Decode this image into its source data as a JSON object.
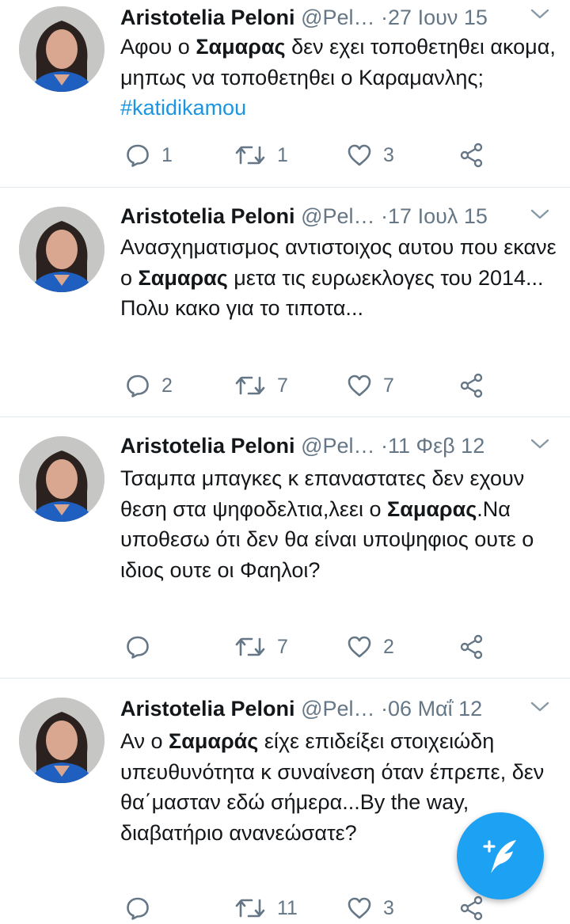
{
  "tweets": [
    {
      "name": "Aristotelia Peloni",
      "handle": "@Pel…",
      "dot": "·",
      "date": "27 Ιουν 15",
      "segments": [
        {
          "text": "Αφου ο ",
          "style": "normal"
        },
        {
          "text": "Σαμαρας",
          "style": "bold"
        },
        {
          "text": " δεν εχει τοποθετηθει ακομα, μηπως να τοποθετηθει ο Καραμανλης; ",
          "style": "normal"
        },
        {
          "text": "#katidikamou",
          "style": "hashtag"
        }
      ],
      "replies": "1",
      "retweets": "1",
      "likes": "3"
    },
    {
      "name": "Aristotelia Peloni",
      "handle": "@Pel…",
      "dot": "·",
      "date": "17 Ιουλ 15",
      "segments": [
        {
          "text": "Ανασχηματισμος αντιστοιχος αυτου που εκανε ο ",
          "style": "normal"
        },
        {
          "text": "Σαμαρας",
          "style": "bold"
        },
        {
          "text": " μετα τις ευρωεκλογες του 2014... Πολυ κακο για το τιποτα...",
          "style": "normal"
        }
      ],
      "replies": "2",
      "retweets": "7",
      "likes": "7"
    },
    {
      "name": "Aristotelia Peloni",
      "handle": "@Pel…",
      "dot": "·",
      "date": "11 Φεβ 12",
      "segments": [
        {
          "text": "Τσαμπα μπαγκες κ επαναστατες δεν εχουν θεση στα ψηφοδελτια,λεει ο ",
          "style": "normal"
        },
        {
          "text": "Σαμαρας",
          "style": "bold"
        },
        {
          "text": ".Να υποθεσω ότι δεν θα είναι υποψηφιος ουτε ο ιδιος ουτε οι Φαηλοι?",
          "style": "normal"
        }
      ],
      "replies": "",
      "retweets": "7",
      "likes": "2"
    },
    {
      "name": "Aristotelia Peloni",
      "handle": "@Pel…",
      "dot": "·",
      "date": "06 Μαΐ 12",
      "segments": [
        {
          "text": "Αν ο ",
          "style": "normal"
        },
        {
          "text": "Σαμαράς",
          "style": "bold"
        },
        {
          "text": " είχε επιδείξει στοιχειώδη υπευθυνότητα κ συναίνεση όταν έπρεπε, δεν θα΄μασταν εδώ σήμερα...By the way, διαβατήριο ανανεώσατε?",
          "style": "normal"
        }
      ],
      "replies": "",
      "retweets": "11",
      "likes": "3"
    }
  ],
  "icons": {
    "reply": "reply-icon",
    "retweet": "retweet-icon",
    "like": "heart-icon",
    "share": "share-icon",
    "caret": "chevron-down-icon",
    "compose": "compose-tweet-icon"
  },
  "colors": {
    "accent": "#1da1f2",
    "hashtag": "#1b95e0",
    "secondary_text": "#657786",
    "divider": "#e1e8ed"
  }
}
